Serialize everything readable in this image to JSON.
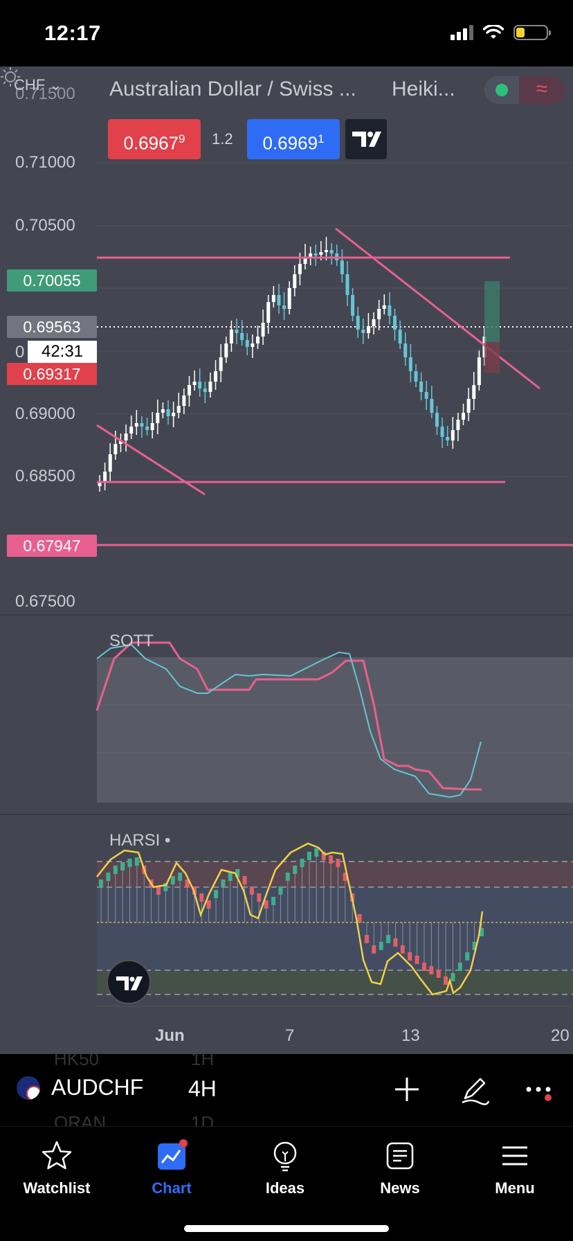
{
  "status_bar": {
    "time": "12:17"
  },
  "chart_header": {
    "currency": "CHF",
    "symbol_title": "Australian Dollar / Swiss ...",
    "chart_type": "Heiki...",
    "sell_price_main": "0.6967",
    "sell_price_sup": "9",
    "spread": "1.2",
    "buy_price_main": "0.6969",
    "buy_price_sup": "1"
  },
  "price_axis": {
    "ticks": [
      "0.71000",
      "0.70500",
      "0.69000",
      "0.68500",
      "0.67500"
    ],
    "partial_top": "0.71500"
  },
  "price_labels": {
    "level_upper": "0.70055",
    "last_price": "0.69563",
    "countdown": "42:31",
    "level_lower": "0.69317",
    "level_bottom": "0.67947",
    "countdown_prefix": "0"
  },
  "indicators": {
    "sott": "SOTT",
    "harsi": "HARSI •"
  },
  "time_axis": {
    "labels": [
      "Jun",
      "7",
      "13",
      "20"
    ]
  },
  "toolbar": {
    "symbol": "AUDCHF",
    "timeframe": "4H",
    "ghost_top": "HK50",
    "ghost_top_tf": "1H",
    "ghost_bottom": "ORAN",
    "ghost_bottom_tf": "1D"
  },
  "tabs": [
    {
      "label": "Watchlist",
      "icon": "star-icon"
    },
    {
      "label": "Chart",
      "icon": "chart-icon"
    },
    {
      "label": "Ideas",
      "icon": "lightbulb-icon"
    },
    {
      "label": "News",
      "icon": "news-icon"
    },
    {
      "label": "Menu",
      "icon": "hamburger-icon"
    }
  ],
  "colors": {
    "chart_bg": "#434651",
    "trendline": "#e8608f",
    "bull_candle": "#ffffff",
    "bear_candle": "#66c5d6",
    "sell": "#e0414b",
    "buy": "#2f6cf5",
    "active_tab": "#2f6cf5"
  }
}
